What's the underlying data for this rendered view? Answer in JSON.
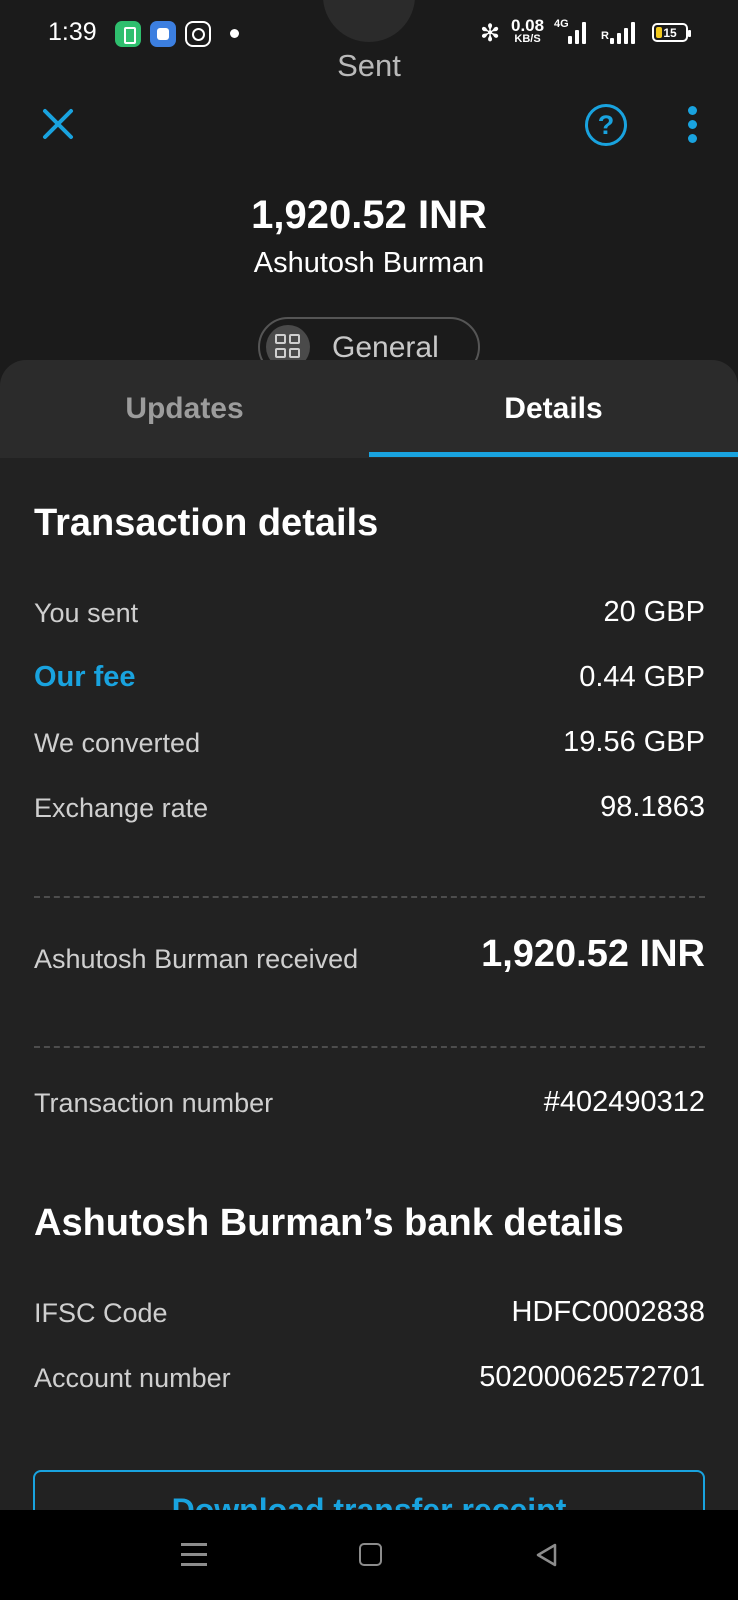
{
  "status_bar": {
    "time": "1:39",
    "network_speed": "0.08",
    "network_speed_unit": "KB/S",
    "network_type": "4G",
    "roaming_label": "R",
    "battery_level": "15",
    "icons": [
      "battery-app-icon",
      "app-switcher-icon",
      "instagram-icon",
      "notification-dot",
      "bluetooth-icon",
      "signal-icon"
    ]
  },
  "header": {
    "title": "Sent",
    "help_glyph": "?",
    "accent_color": "#19a3df"
  },
  "summary": {
    "amount": "1,920.52 INR",
    "recipient": "Ashutosh Burman",
    "category": "General"
  },
  "tabs": [
    {
      "label": "Updates",
      "active": false
    },
    {
      "label": "Details",
      "active": true
    }
  ],
  "transaction_details": {
    "title": "Transaction details",
    "rows": [
      {
        "label": "You sent",
        "value": "20 GBP"
      },
      {
        "label": "Our fee",
        "value": "0.44 GBP"
      },
      {
        "label": "We converted",
        "value": "19.56 GBP"
      },
      {
        "label": "Exchange rate",
        "value": "98.1863"
      }
    ],
    "received": {
      "label": "Ashutosh Burman received",
      "value": "1,920.52 INR"
    },
    "transaction_number": {
      "label": "Transaction number",
      "value": "#402490312"
    }
  },
  "bank_details": {
    "title": "Ashutosh Burman’s bank details",
    "rows": [
      {
        "label": "IFSC Code",
        "value": "HDFC0002838"
      },
      {
        "label": "Account number",
        "value": "50200062572701"
      }
    ]
  },
  "actions": {
    "download_label": "Download transfer receipt"
  }
}
